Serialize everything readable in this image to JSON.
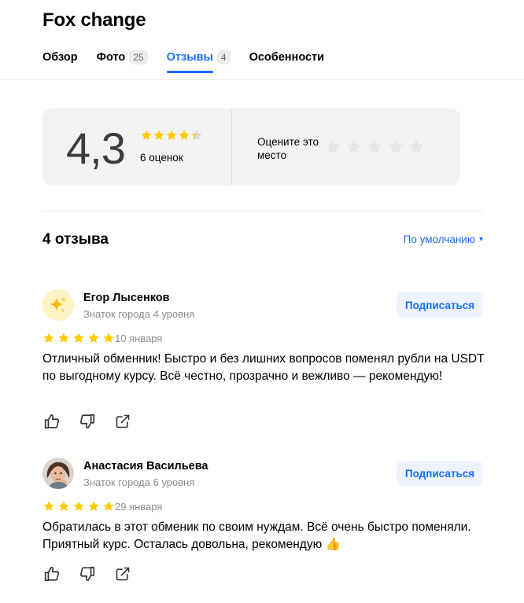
{
  "place": {
    "title": "Fox change"
  },
  "tabs": [
    {
      "label": "Обзор",
      "count": ""
    },
    {
      "label": "Фото",
      "count": "25"
    },
    {
      "label": "Отзывы",
      "count": "4",
      "active": true
    },
    {
      "label": "Особенности",
      "count": ""
    }
  ],
  "rating": {
    "score": "4,3",
    "score_stars_fraction": 0.86,
    "count_label": "6 оценок",
    "rate_prompt": "Оцените это место",
    "rate_stars_total": 5
  },
  "reviews_section": {
    "heading": "4 отзыва",
    "sort_label": "По умолчанию",
    "sort_caret": "▾"
  },
  "reviews": [
    {
      "author": "Егор Лысенков",
      "level": "Знаток города 4 уровня",
      "avatar_icon": "sparkles-icon",
      "subscribe_label": "Подписаться",
      "stars": 5,
      "date": "10 января",
      "text": "Отличный обменник! Быстро и без лишних вопросов поменял рубли на USDT по выгодному курсу. Всё честно, прозрачно и вежливо — рекомендую!"
    },
    {
      "author": "Анастасия Васильева",
      "level": "Знаток города 6 уровня",
      "avatar_icon": "user-photo",
      "subscribe_label": "Подписаться",
      "stars": 5,
      "date": "29 января",
      "text": "Обратилась в этот обменик по своим нуждам. Всё очень быстро поменяли. Приятный курс. Осталась довольна, рекомендую 👍"
    }
  ],
  "colors": {
    "accent": "#196dff",
    "star": "#ffcc00",
    "star_empty": "#e5e5e5",
    "card_bg": "#f2f2f2"
  }
}
